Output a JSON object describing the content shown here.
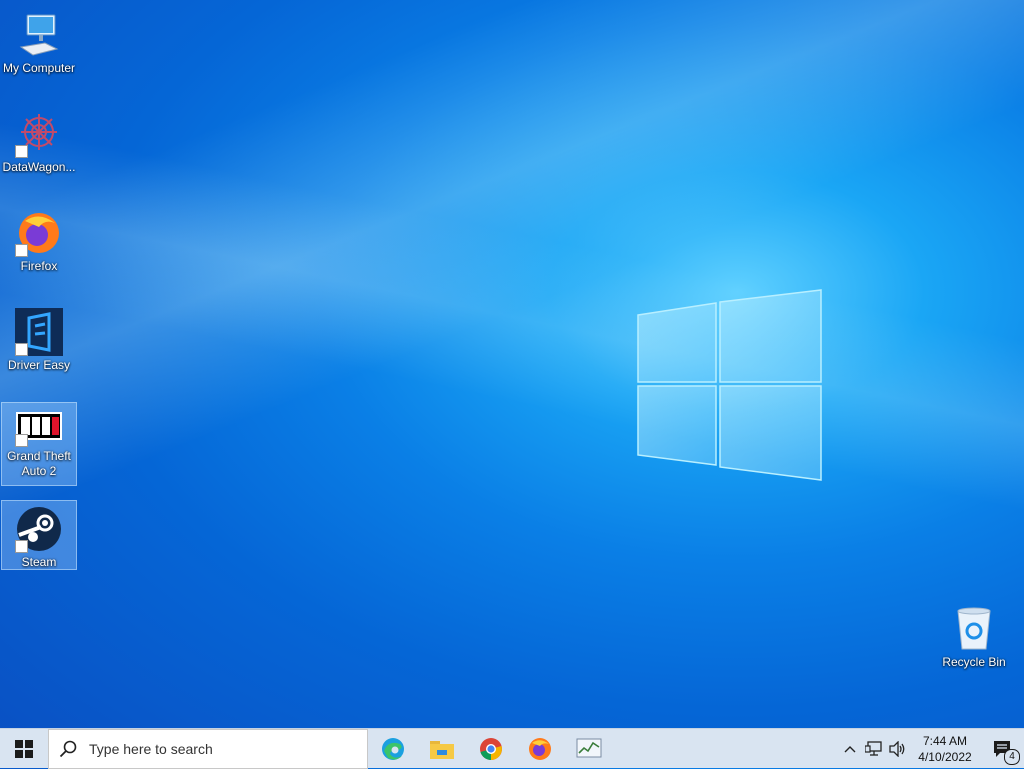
{
  "desktop": {
    "icons": [
      {
        "label": "My Computer"
      },
      {
        "label": "DataWagon..."
      },
      {
        "label": "Firefox"
      },
      {
        "label": "Driver Easy"
      },
      {
        "label": "Grand Theft Auto 2"
      },
      {
        "label": "Steam"
      },
      {
        "label": "Recycle Bin"
      }
    ]
  },
  "taskbar": {
    "search_placeholder": "Type here to search",
    "apps": [
      "edge-icon",
      "file-explorer-icon",
      "chrome-icon",
      "firefox-icon",
      "task-manager-icon"
    ],
    "clock_time": "7:44 AM",
    "clock_date": "4/10/2022",
    "notification_count": "4"
  },
  "colors": {
    "taskbar_bg": "#d9e4f1",
    "desktop_blue": "#0a7fe6"
  }
}
